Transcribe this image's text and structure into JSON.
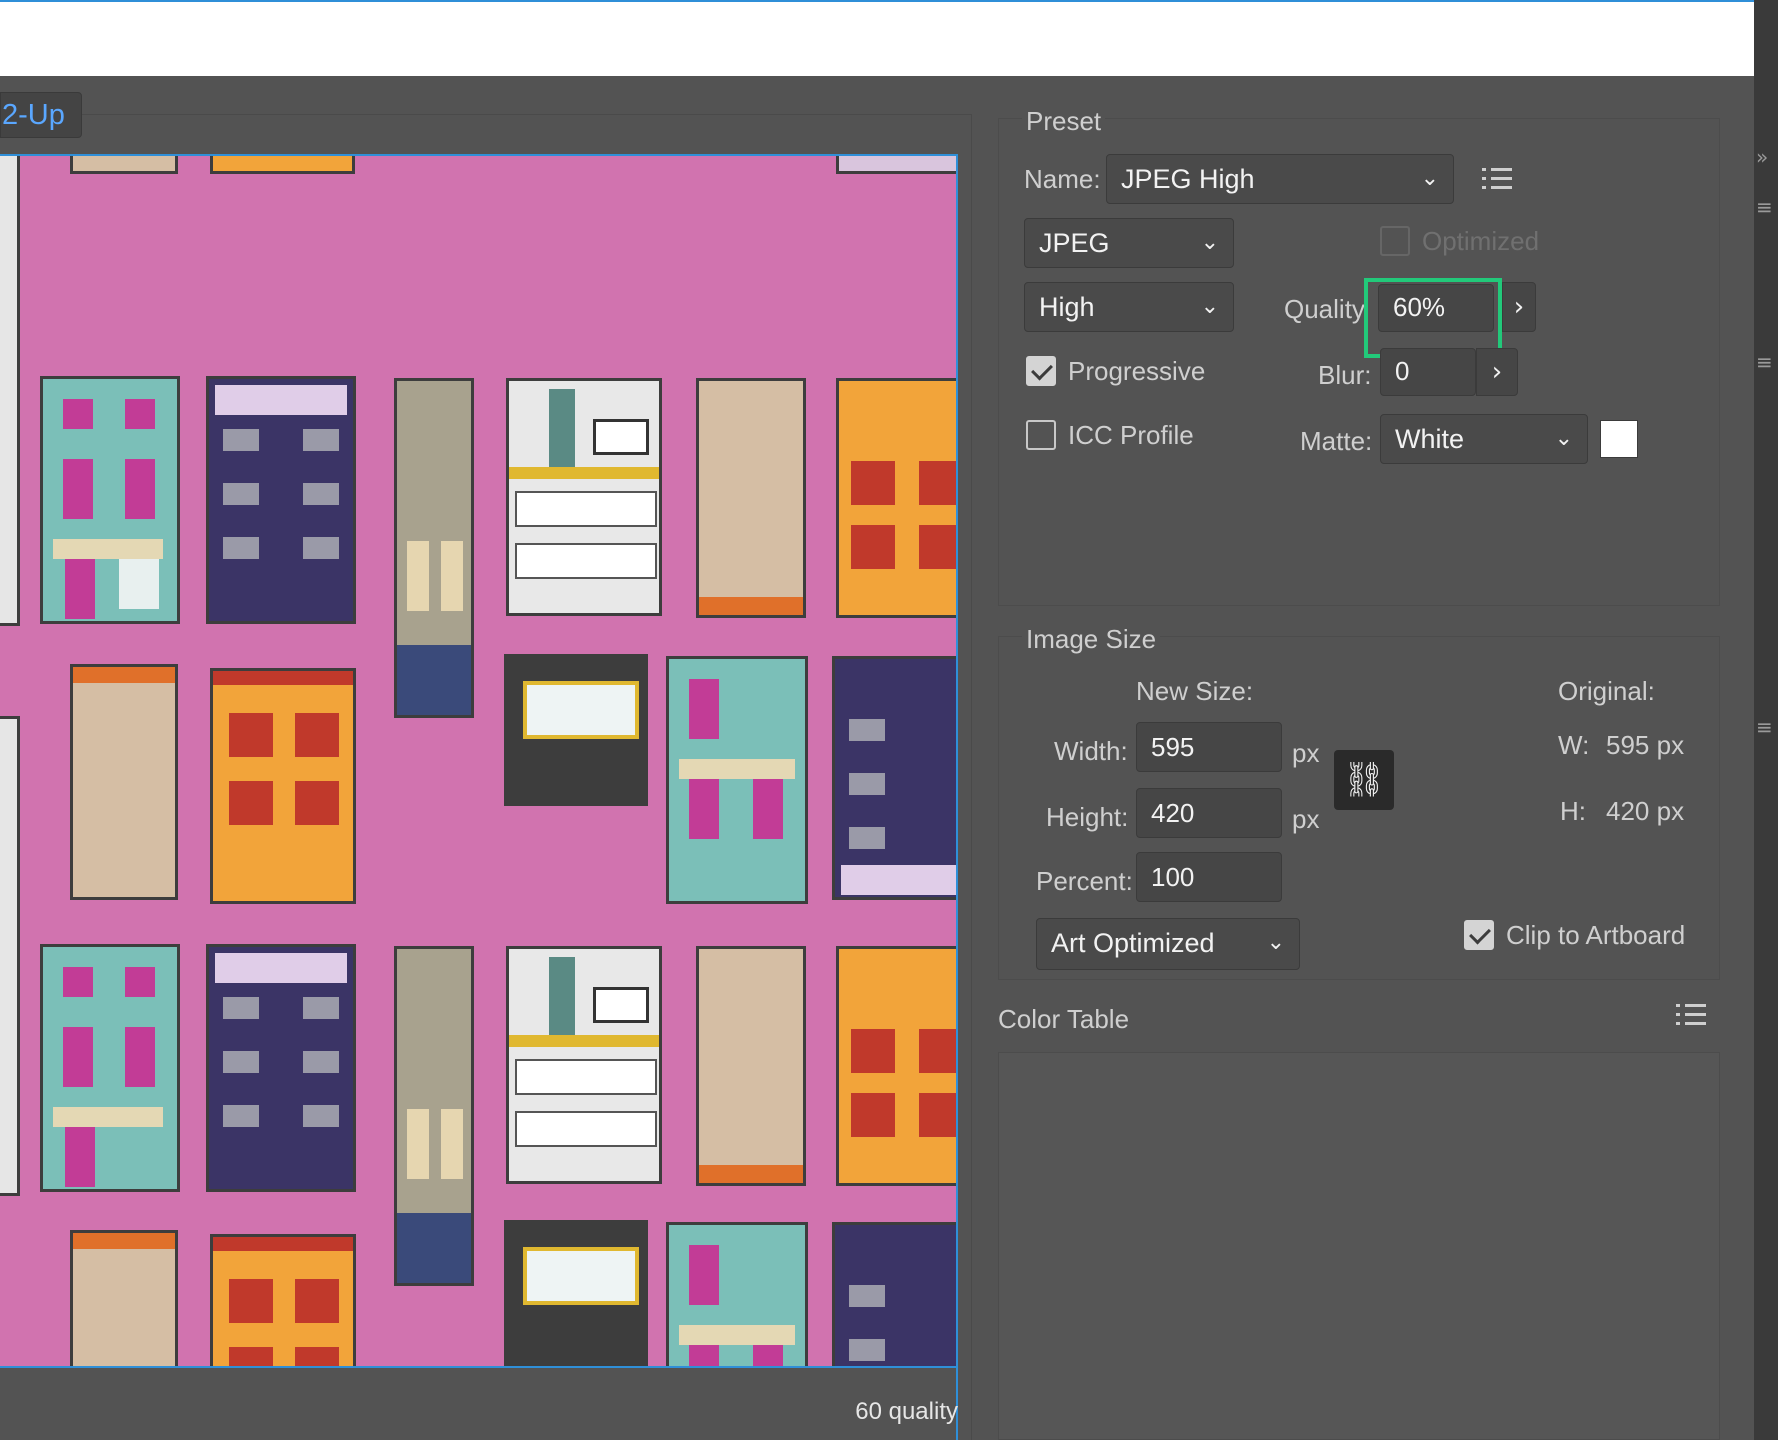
{
  "view_tab": {
    "label": "2-Up"
  },
  "preview": {
    "caption": "60 quality"
  },
  "preset": {
    "section_title": "Preset",
    "name_label": "Name:",
    "name_value": "JPEG High",
    "format_value": "JPEG",
    "optimized_label": "Optimized",
    "compression_value": "High",
    "quality_label": "Quality",
    "quality_value": "60%",
    "progressive_label": "Progressive",
    "progressive_checked": true,
    "blur_label": "Blur:",
    "blur_value": "0",
    "icc_label": "ICC Profile",
    "icc_checked": false,
    "matte_label": "Matte:",
    "matte_value": "White",
    "matte_color": "#ffffff"
  },
  "image_size": {
    "section_title": "Image Size",
    "new_size_label": "New Size:",
    "original_label": "Original:",
    "width_label": "Width:",
    "width_value": "595",
    "height_label": "Height:",
    "height_value": "420",
    "percent_label": "Percent:",
    "percent_value": "100",
    "unit": "px",
    "orig_w_label": "W:",
    "orig_w_value": "595 px",
    "orig_h_label": "H:",
    "orig_h_value": "420 px",
    "resample_value": "Art Optimized",
    "clip_label": "Clip to Artboard",
    "clip_checked": true
  },
  "color_table": {
    "section_title": "Color Table"
  },
  "colors": {
    "highlight": "#22c97a",
    "accent": "#2f8fd8",
    "canvas_bg": "#d173af"
  }
}
